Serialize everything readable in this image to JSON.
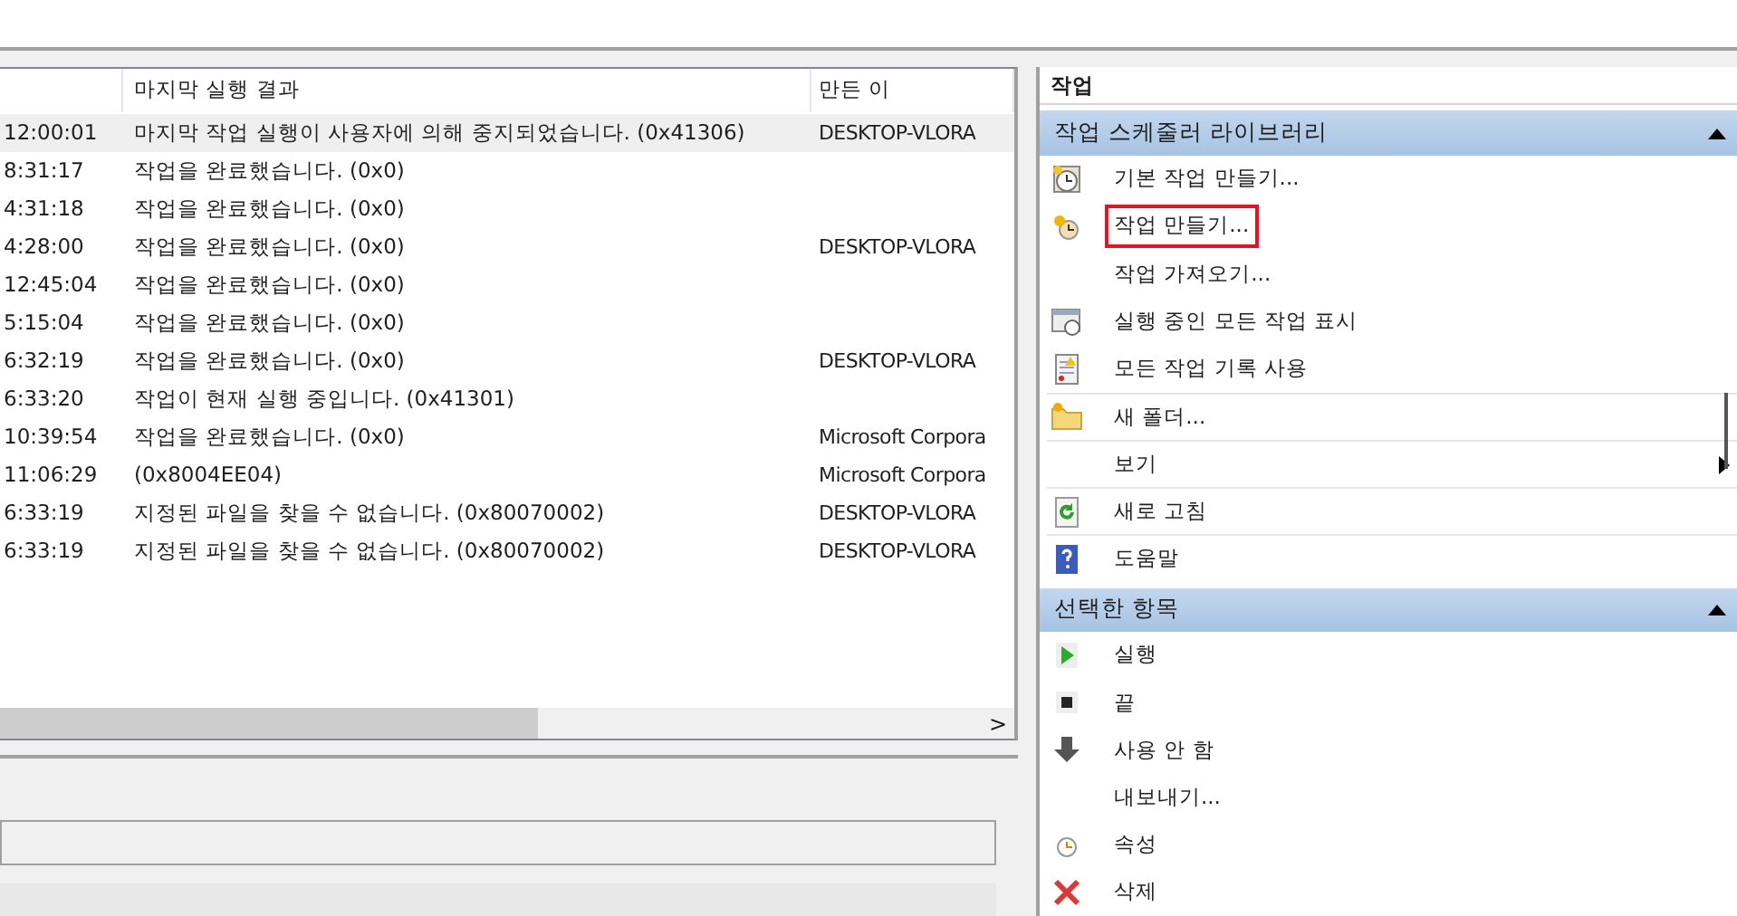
{
  "table": {
    "columns": [
      "마지막 실행 결과",
      "만든 이"
    ],
    "rows": [
      {
        "time": "12:00:01",
        "result": "마지막 작업 실행이 사용자에 의해 중지되었습니다. (0x41306)",
        "author": "DESKTOP-VLORA",
        "selected": true
      },
      {
        "time": "8:31:17",
        "result": "작업을 완료했습니다. (0x0)",
        "author": "",
        "selected": false
      },
      {
        "time": "4:31:18",
        "result": "작업을 완료했습니다. (0x0)",
        "author": "",
        "selected": false
      },
      {
        "time": "4:28:00",
        "result": "작업을 완료했습니다. (0x0)",
        "author": "DESKTOP-VLORA",
        "selected": false
      },
      {
        "time": "12:45:04",
        "result": "작업을 완료했습니다. (0x0)",
        "author": "",
        "selected": false
      },
      {
        "time": "5:15:04",
        "result": "작업을 완료했습니다. (0x0)",
        "author": "",
        "selected": false
      },
      {
        "time": "6:32:19",
        "result": "작업을 완료했습니다. (0x0)",
        "author": "DESKTOP-VLORA",
        "selected": false
      },
      {
        "time": "6:33:20",
        "result": "작업이 현재 실행 중입니다. (0x41301)",
        "author": "",
        "selected": false
      },
      {
        "time": "10:39:54",
        "result": "작업을 완료했습니다. (0x0)",
        "author": "Microsoft Corpora",
        "selected": false
      },
      {
        "time": "11:06:29",
        "result": "(0x8004EE04)",
        "author": "Microsoft Corpora",
        "selected": false
      },
      {
        "time": "6:33:19",
        "result": "지정된 파일을 찾을 수 없습니다. (0x80070002)",
        "author": "DESKTOP-VLORA",
        "selected": false
      },
      {
        "time": "6:33:19",
        "result": "지정된 파일을 찾을 수 없습니다. (0x80070002)",
        "author": "DESKTOP-VLORA",
        "selected": false
      }
    ],
    "scroll_arrow": ">"
  },
  "actions": {
    "title": "작업",
    "sections": [
      {
        "title": "작업 스케줄러 라이브러리",
        "expanded": true,
        "items": [
          {
            "label": "기본 작업 만들기...",
            "highlighted": false
          },
          {
            "label": "작업 만들기...",
            "highlighted": true
          },
          {
            "label": "작업 가져오기...",
            "highlighted": false
          },
          {
            "label": "실행 중인 모든 작업 표시",
            "highlighted": false
          },
          {
            "label": "모든 작업 기록 사용",
            "highlighted": false
          },
          {
            "label": "새 폴더...",
            "highlighted": false
          },
          {
            "label": "보기",
            "highlighted": false,
            "submenu": true
          },
          {
            "label": "새로 고침",
            "highlighted": false
          },
          {
            "label": "도움말",
            "highlighted": false
          }
        ]
      },
      {
        "title": "선택한 항목",
        "expanded": true,
        "items": [
          {
            "label": "실행",
            "highlighted": false
          },
          {
            "label": "끝",
            "highlighted": false
          },
          {
            "label": "사용 안 함",
            "highlighted": false
          },
          {
            "label": "내보내기...",
            "highlighted": false
          },
          {
            "label": "속성",
            "highlighted": false
          },
          {
            "label": "삭제",
            "highlighted": false
          }
        ]
      }
    ]
  }
}
